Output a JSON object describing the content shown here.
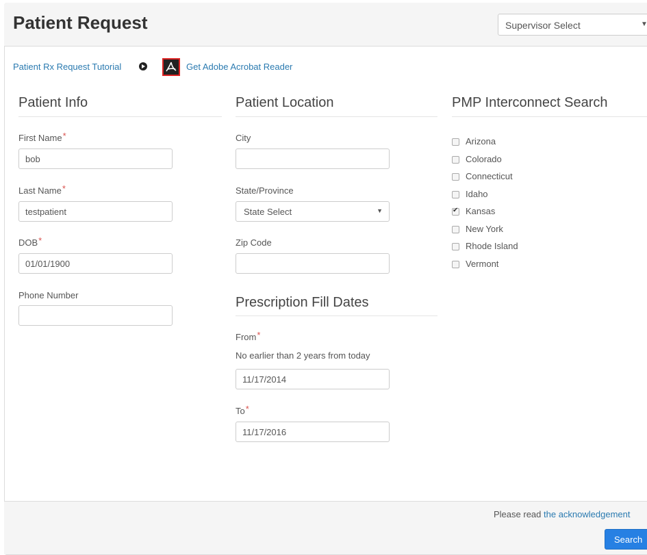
{
  "header": {
    "title": "Patient Request",
    "supervisor_select": "Supervisor Select"
  },
  "links": {
    "tutorial": "Patient Rx Request Tutorial",
    "acrobat": "Get Adobe Acrobat Reader"
  },
  "patient_info": {
    "heading": "Patient Info",
    "first_name_label": "First Name",
    "first_name_value": "bob",
    "last_name_label": "Last Name",
    "last_name_value": "testpatient",
    "dob_label": "DOB",
    "dob_value": "01/01/1900",
    "phone_label": "Phone Number",
    "phone_value": "",
    "required_marker": "*"
  },
  "patient_location": {
    "heading": "Patient Location",
    "city_label": "City",
    "city_value": "",
    "state_label": "State/Province",
    "state_value": "State Select",
    "zip_label": "Zip Code",
    "zip_value": ""
  },
  "fill_dates": {
    "heading": "Prescription Fill Dates",
    "from_label": "From",
    "from_hint": "No earlier than 2 years from today",
    "from_value": "11/17/2014",
    "to_label": "To",
    "to_value": "11/17/2016"
  },
  "pmp": {
    "heading": "PMP Interconnect Search",
    "states": [
      {
        "name": "Arizona",
        "checked": false
      },
      {
        "name": "Colorado",
        "checked": false
      },
      {
        "name": "Connecticut",
        "checked": false
      },
      {
        "name": "Idaho",
        "checked": false
      },
      {
        "name": "Kansas",
        "checked": true
      },
      {
        "name": "New York",
        "checked": false
      },
      {
        "name": "Rhode Island",
        "checked": false
      },
      {
        "name": "Vermont",
        "checked": false
      }
    ]
  },
  "footer": {
    "ack_prefix": "Please read",
    "ack_link": "the acknowledgement",
    "search_label": "Search"
  }
}
